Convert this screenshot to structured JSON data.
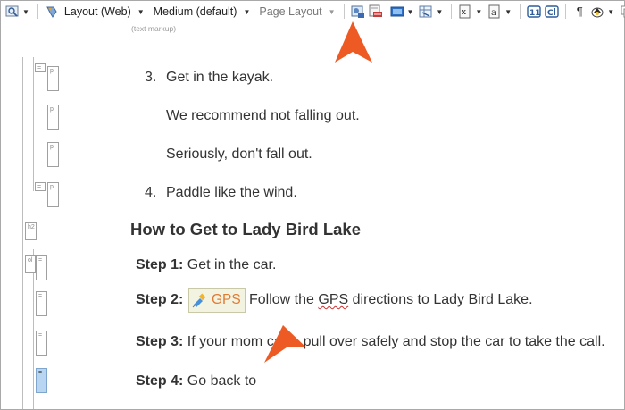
{
  "toolbar": {
    "layout_label": "Layout (Web)",
    "size_label": "Medium (default)",
    "page_layout_label": "Page Layout",
    "text_markup_hint": "(text markup)"
  },
  "doc": {
    "item3_num": "3.",
    "item3_text": "Get in the kayak.",
    "item3_p1": "We recommend not falling out.",
    "item3_p2": "Seriously, don't fall out.",
    "item4_num": "4.",
    "item4_text": "Paddle like the wind.",
    "heading": "How to Get to Lady Bird Lake",
    "step1_label": "Step 1:",
    "step1_text": "Get in the car.",
    "step2_label": "Step 2:",
    "gps_label": "GPS",
    "step2_text_a": "Follow the ",
    "step2_text_gps": "GPS",
    "step2_text_b": " directions to Lady Bird Lake.",
    "step3_label": "Step 3:",
    "step3_text": "If your mom calls, pull over safely and stop the car to take the call.",
    "step4_label": "Step 4:",
    "step4_text": "Go back to "
  },
  "colors": {
    "arrow": "#ee5a24",
    "gps_text": "#e07b32",
    "selection": "#b8d6f2"
  },
  "icons": [
    "preview-icon",
    "layout-icon",
    "insert-image-icon",
    "insert-link-icon",
    "insert-media-icon",
    "insert-table-icon",
    "insert-field-icon",
    "insert-variable-icon",
    "insert-snippet-icon",
    "text-box-icon",
    "condition-icon",
    "paragraph-mark-icon",
    "highlight-icon",
    "copy-icon"
  ]
}
